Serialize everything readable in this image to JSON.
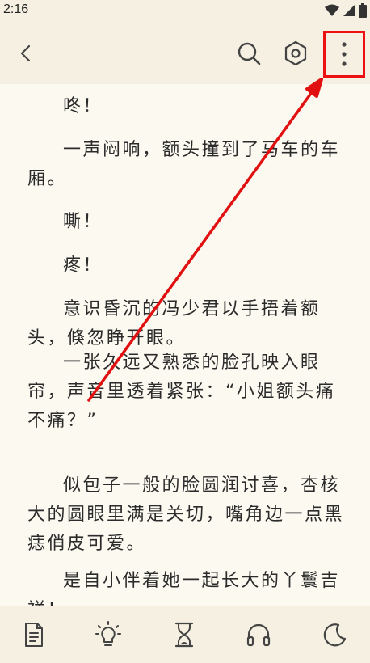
{
  "status": {
    "time": "2:16"
  },
  "paragraphs": [
    "咚！",
    "一声闷响，额头撞到了马车的车厢。",
    "嘶！",
    "疼！",
    "意识昏沉的冯少君以手捂着额头，倏忽睁开眼。",
    "一张久远又熟悉的脸孔映入眼帘，声音里透着紧张：“小姐额头痛不痛？”",
    "似包子一般的脸圆润讨喜，杏核大的圆眼里满是关切，嘴角边一点黑痣俏皮可爱。",
    "是自小伴着她一起长大的丫鬟吉祥！"
  ],
  "icons": {
    "back": "back-arrow-icon",
    "search": "search-icon",
    "settings": "settings-hexagon-icon",
    "more": "more-vertical-icon",
    "catalog": "document-icon",
    "brightness": "bulb-icon",
    "timer": "hourglass-icon",
    "listen": "headphones-icon",
    "night": "moon-icon"
  },
  "colors": {
    "highlight": "#e11111",
    "background": "#fbf9f0",
    "bar": "#f5f0e2"
  }
}
